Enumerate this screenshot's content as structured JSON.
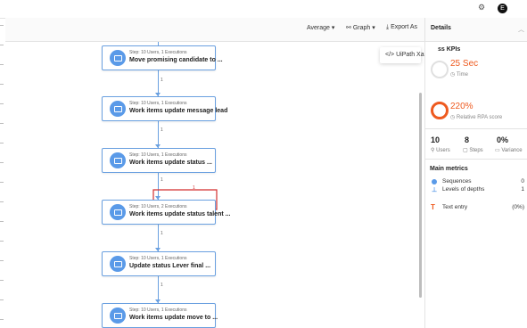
{
  "topbar": {
    "icon_name": "settings-icon",
    "avatar_letter": "E"
  },
  "toolbar": {
    "average_label": "Average",
    "graph_label": "Graph",
    "export_label": "Export As",
    "caret": "▾"
  },
  "export_menu": {
    "item_label": "UiPath Xaml",
    "item_icon": "</>"
  },
  "nodes": [
    {
      "sub": "Step: 10 Users, 1 Executions",
      "title": "Move promising candidate to ..."
    },
    {
      "sub": "Step: 10 Users, 1 Executions",
      "title": "Work items update message lead"
    },
    {
      "sub": "Step: 10 Users, 1 Executions",
      "title": "Work items update status ..."
    },
    {
      "sub": "Step: 10 Users, 2 Executions",
      "title": "Work items update status talent ..."
    },
    {
      "sub": "Step: 10 Users, 1 Executions",
      "title": "Update status Lever final ..."
    },
    {
      "sub": "Step: 10 Users, 1 Executions",
      "title": "Work items update move to ..."
    }
  ],
  "edge_labels": [
    "1",
    "1",
    "1",
    "1",
    "1"
  ],
  "loop_label": "1",
  "panel": {
    "title": "Details",
    "kpi_heading": "ss KPIs",
    "time_value": "25 Sec",
    "time_label": "Time",
    "rpa_value": "220%",
    "rpa_label": "Relative RPA score",
    "stats": [
      {
        "value": "10",
        "label": "Users"
      },
      {
        "value": "8",
        "label": "Steps"
      },
      {
        "value": "0%",
        "label": "Variance"
      }
    ],
    "metrics_title": "Main metrics",
    "metrics": [
      {
        "label": "Sequences",
        "value": "0"
      },
      {
        "label": "Levels of depths",
        "value": "1"
      },
      {
        "label": "Text entry",
        "value": "(0%)"
      }
    ]
  },
  "colors": {
    "accent": "#5a9ae8",
    "warning": "#ee5a1f",
    "loop": "#d32f2f"
  }
}
